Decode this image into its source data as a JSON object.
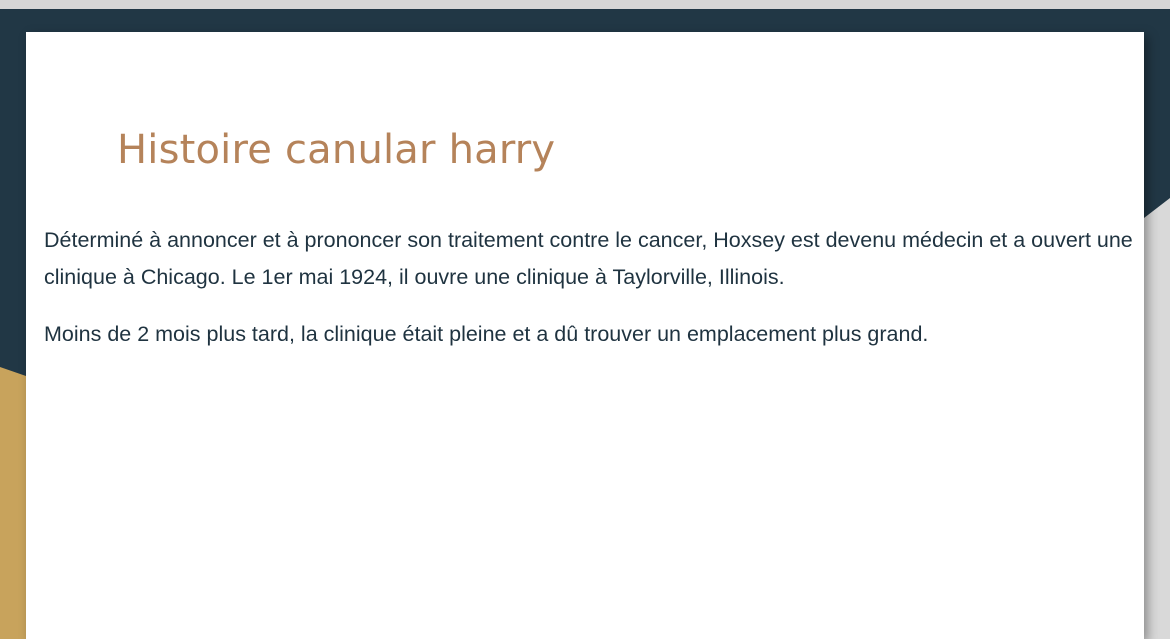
{
  "slide": {
    "title": "Histoire canular harry",
    "paragraphs": [
      "Déterminé à annoncer et à prononcer son traitement contre le cancer, Hoxsey est devenu médecin et a ouvert une clinique à Chicago. Le 1er mai 1924, il ouvre une clinique à Taylorville, Illinois.",
      "Moins de 2 mois plus tard, la clinique était pleine et a dû trouver un emplacement plus grand."
    ]
  },
  "theme": {
    "navy": "#213745",
    "gold": "#c8a35c",
    "title_color": "#b5835a",
    "text_color": "#1f3340",
    "slide_background": "#ffffff"
  }
}
